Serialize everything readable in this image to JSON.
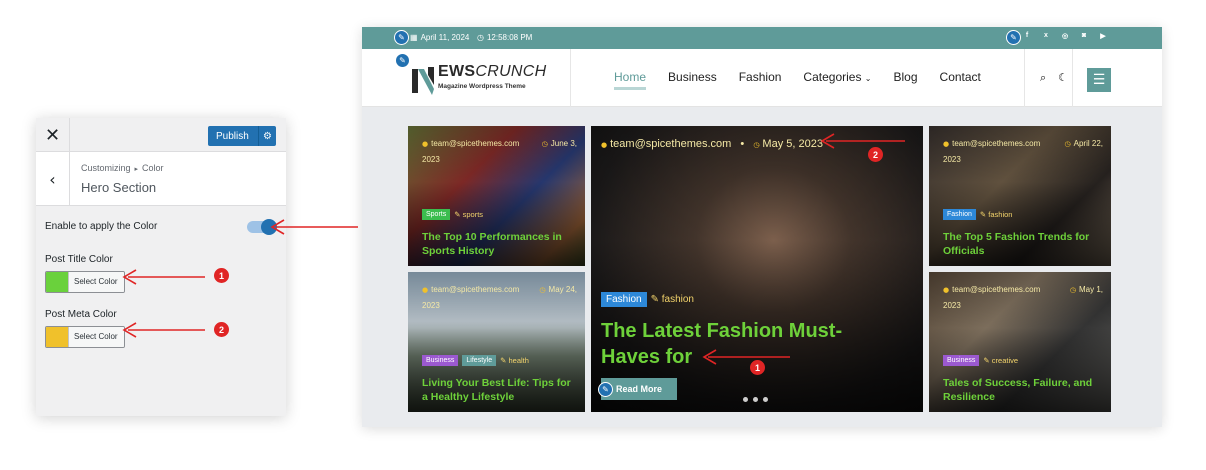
{
  "customizer": {
    "close_icon": "✕",
    "publish_label": "Publish",
    "breadcrumb": [
      "Customizing",
      "Color"
    ],
    "section_title": "Hero Section",
    "toggle_label": "Enable to apply the Color",
    "toggle_on": true,
    "controls": [
      {
        "label": "Post Title Color",
        "button": "Select Color",
        "color": "#6ad13c"
      },
      {
        "label": "Post Meta Color",
        "button": "Select Color",
        "color": "#f0c12b"
      }
    ]
  },
  "site": {
    "topbar": {
      "date": "April 11, 2024",
      "time": "12:58:08 PM",
      "socials": [
        "f",
        "x",
        "p",
        "ig",
        "yt"
      ]
    },
    "logo": {
      "name_bold": "EWS",
      "name_italic": "CRUNCH",
      "tagline": "Magazine Wordpress Theme"
    },
    "nav": [
      "Home",
      "Business",
      "Fashion",
      "Categories",
      "Blog",
      "Contact"
    ],
    "cards": {
      "c1": {
        "author": "team@spicethemes.com",
        "date_a": "June 3,",
        "date_b": "2023",
        "tags": [
          "Sports"
        ],
        "tag_plain": "sports",
        "title": "The Top 10 Performances in Sports History"
      },
      "c2": {
        "author": "team@spicethemes.com",
        "date_a": "May 24,",
        "date_b": "2023",
        "tags": [
          "Business",
          "Lifestyle"
        ],
        "tag_plain": "health",
        "title": "Living Your Best Life: Tips for a Healthy Lifestyle"
      },
      "main": {
        "author": "team@spicethemes.com",
        "date": "May 5, 2023",
        "tags": [
          "Fashion"
        ],
        "tag_plain": "fashion",
        "title": "The Latest Fashion Must-Haves for",
        "read_more": "Read More"
      },
      "c3": {
        "author": "team@spicethemes.com",
        "date_a": "April 22,",
        "date_b": "2023",
        "tags": [
          "Fashion"
        ],
        "tag_plain": "fashion",
        "title": "The Top 5 Fashion Trends for Officials"
      },
      "c4": {
        "author": "team@spicethemes.com",
        "date_a": "May 1,",
        "date_b": "2023",
        "tags": [
          "Business"
        ],
        "tag_plain": "creative",
        "title": "Tales of Success, Failure, and Resilience"
      }
    }
  },
  "callouts": {
    "one": "1",
    "two": "2"
  },
  "colors": {
    "accent": "#5f9b99",
    "title_green": "#6ed13a",
    "meta_yellow": "#f0c12b",
    "wp_blue": "#2271b1",
    "arrow_red": "#e02525"
  }
}
